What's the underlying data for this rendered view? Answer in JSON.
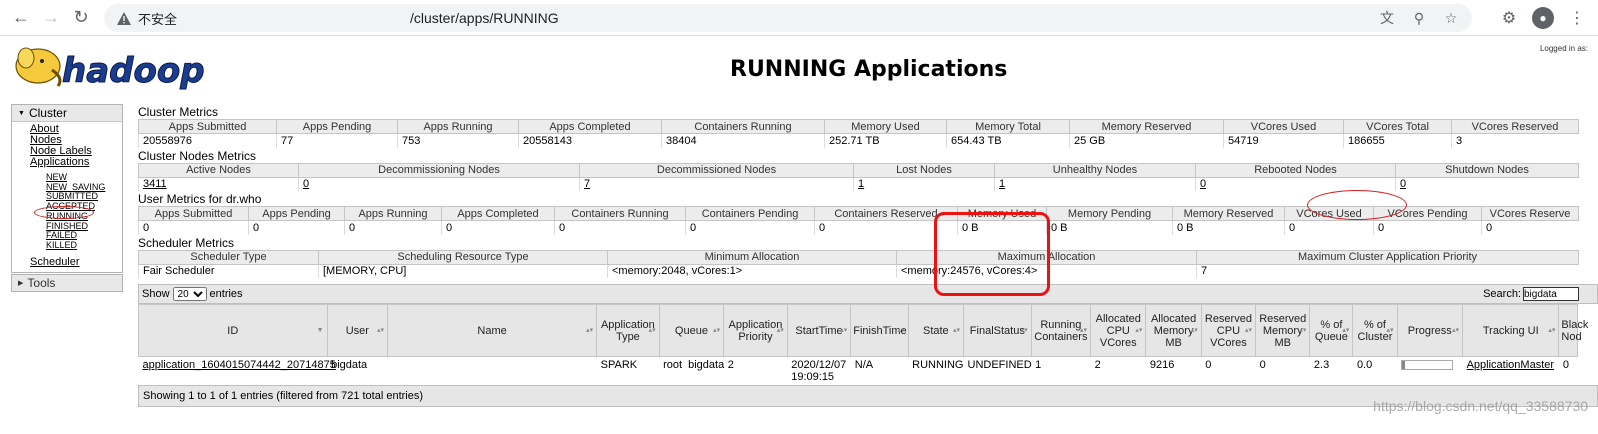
{
  "browser": {
    "insecure_label": "不安全",
    "url_path": "/cluster/apps/RUNNING"
  },
  "header": {
    "title": "RUNNING Applications",
    "logged_in": "Logged in as:",
    "logo_text": "hadoop"
  },
  "nav": {
    "cluster_label": "Cluster",
    "items": [
      "About",
      "Nodes",
      "Node Labels",
      "Applications"
    ],
    "app_states": [
      "NEW",
      "NEW_SAVING",
      "SUBMITTED",
      "ACCEPTED",
      "RUNNING",
      "FINISHED",
      "FAILED",
      "KILLED"
    ],
    "scheduler": "Scheduler",
    "tools_label": "Tools"
  },
  "cluster_metrics": {
    "title": "Cluster Metrics",
    "headers": [
      "Apps Submitted",
      "Apps Pending",
      "Apps Running",
      "Apps Completed",
      "Containers Running",
      "Memory Used",
      "Memory Total",
      "Memory Reserved",
      "VCores Used",
      "VCores Total",
      "VCores Reserved"
    ],
    "values": [
      "20558976",
      "77",
      "753",
      "20558143",
      "38404",
      "252.71 TB",
      "654.43 TB",
      "25 GB",
      "54719",
      "186655",
      "3"
    ]
  },
  "node_metrics": {
    "title": "Cluster Nodes Metrics",
    "headers": [
      "Active Nodes",
      "Decommissioning Nodes",
      "Decommissioned Nodes",
      "Lost Nodes",
      "Unhealthy Nodes",
      "Rebooted Nodes",
      "Shutdown Nodes"
    ],
    "values": [
      "3411",
      "0",
      "7",
      "1",
      "1",
      "0",
      "0"
    ]
  },
  "user_metrics": {
    "title": "User Metrics for dr.who",
    "headers": [
      "Apps Submitted",
      "Apps Pending",
      "Apps Running",
      "Apps Completed",
      "Containers Running",
      "Containers Pending",
      "Containers Reserved",
      "Memory Used",
      "Memory Pending",
      "Memory Reserved",
      "VCores Used",
      "VCores Pending",
      "VCores Reserve"
    ],
    "values": [
      "0",
      "0",
      "0",
      "0",
      "0",
      "0",
      "0",
      "0 B",
      "0 B",
      "0 B",
      "0",
      "0",
      "0"
    ]
  },
  "scheduler_metrics": {
    "title": "Scheduler Metrics",
    "headers": [
      "Scheduler Type",
      "Scheduling Resource Type",
      "Minimum Allocation",
      "Maximum Allocation",
      "Maximum Cluster Application Priority"
    ],
    "values": [
      "Fair Scheduler",
      "[MEMORY, CPU]",
      "<memory:2048, vCores:1>",
      "<memory:24576, vCores:4>",
      "7"
    ]
  },
  "apps_table": {
    "show_label": "Show",
    "page_size": "20",
    "entries_label": "entries",
    "search_label": "Search:",
    "search_value": "bigdata",
    "columns": [
      "ID",
      "User",
      "Name",
      "Application Type",
      "Queue",
      "Application Priority",
      "StartTime",
      "FinishTime",
      "State",
      "FinalStatus",
      "Running Containers",
      "Allocated CPU VCores",
      "Allocated Memory MB",
      "Reserved CPU VCores",
      "Reserved Memory MB",
      "% of Queue",
      "% of Cluster",
      "Progress",
      "Tracking UI",
      "Black Nod"
    ],
    "rows": [
      {
        "id": "application_1604015074442_20714875",
        "user": "bigdata",
        "name": "",
        "type": "SPARK",
        "queue_prefix": "root",
        "queue": "bigdata",
        "priority": "2",
        "start_time": "2020/12/07 19:09:15",
        "finish_time": "N/A",
        "state": "RUNNING",
        "final_status": "UNDEFINED",
        "running_containers": "1",
        "alloc_vcores": "2",
        "alloc_memory": "9216",
        "reserved_vcores": "0",
        "reserved_memory": "0",
        "pct_queue": "2.3",
        "pct_cluster": "0.0",
        "progress": 0.05,
        "tracking_ui": "ApplicationMaster",
        "blacklisted": "0"
      }
    ],
    "footer": "Showing 1 to 1 of 1 entries (filtered from 721 total entries)"
  },
  "watermark": "https://blog.csdn.net/qq_33588730",
  "colors": {
    "highlight": "#e11111",
    "header_bg": "#e6e6e6"
  }
}
